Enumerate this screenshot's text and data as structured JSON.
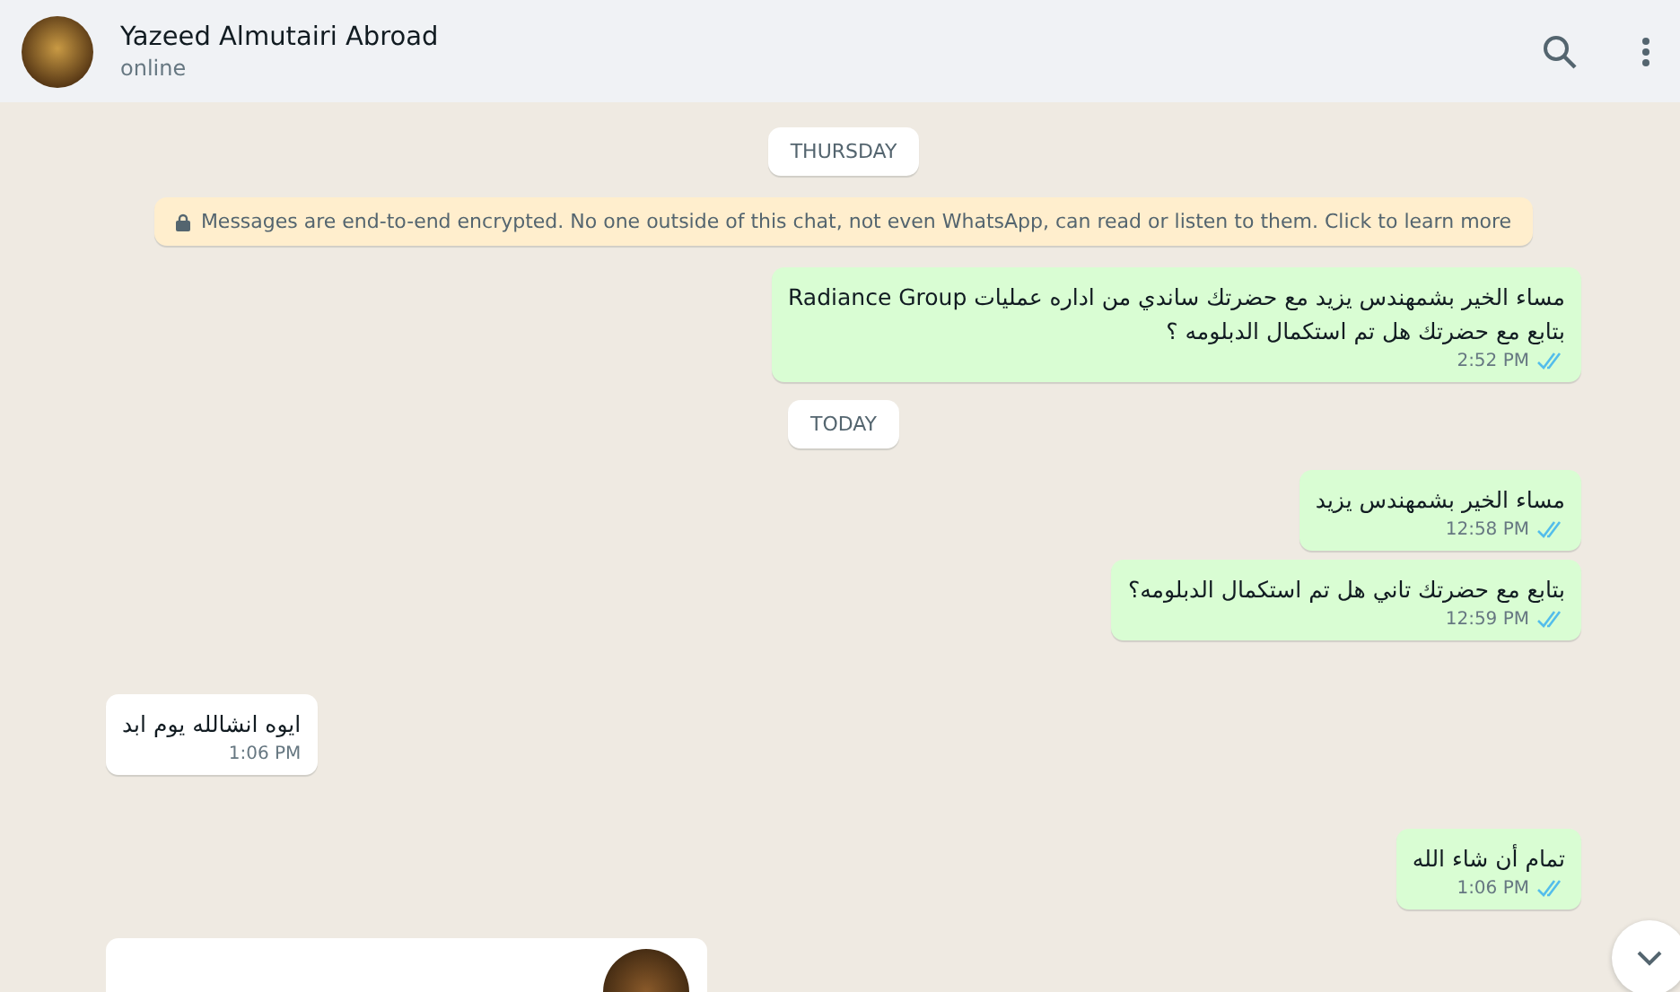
{
  "header": {
    "name": "Yazeed Almutairi Abroad",
    "status": "online"
  },
  "items": [
    {
      "kind": "date",
      "text": "THURSDAY"
    },
    {
      "kind": "notice",
      "text": "Messages are end-to-end encrypted. No one outside of this chat, not even WhatsApp, can read or listen to them. Click to learn more"
    },
    {
      "kind": "message",
      "outgoing": true,
      "read": true,
      "lines": [
        "مساء الخير بشمهندس يزيد مع حضرتك ساندي من اداره عمليات Radiance Group",
        "بتابع مع حضرتك هل تم استكمال الدبلومه ؟"
      ],
      "time": "2:52 PM"
    },
    {
      "kind": "date",
      "text": "TODAY"
    },
    {
      "kind": "message",
      "outgoing": true,
      "read": true,
      "lines": [
        "مساء الخير بشمهندس يزيد"
      ],
      "time": "12:58 PM"
    },
    {
      "kind": "message",
      "outgoing": true,
      "read": true,
      "lines": [
        "بتابع مع حضرتك تاني هل تم استكمال الدبلومه؟"
      ],
      "time": "12:59 PM"
    },
    {
      "kind": "message",
      "outgoing": false,
      "lines": [
        "ايوه انشالله يوم ابد"
      ],
      "time": "1:06 PM"
    },
    {
      "kind": "message",
      "outgoing": true,
      "read": true,
      "lines": [
        "تمام أن شاء الله"
      ],
      "time": "1:06 PM"
    },
    {
      "kind": "photo",
      "outgoing": false
    }
  ]
}
